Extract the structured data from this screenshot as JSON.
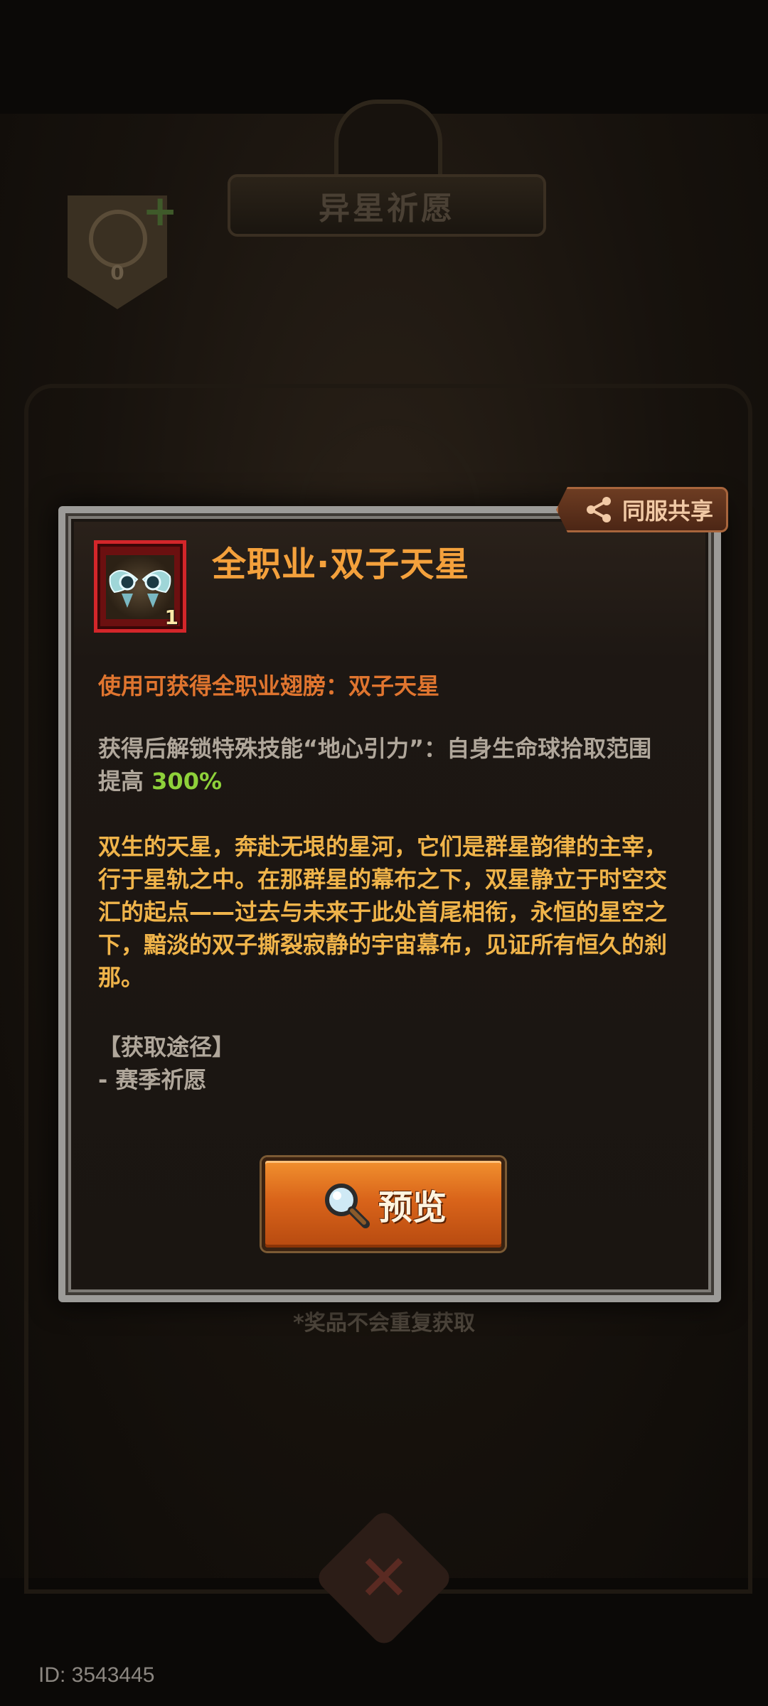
{
  "background": {
    "banner_title": "异星祈愿",
    "counter_value": "0",
    "note": "*奖品不会重复获取",
    "id_label": "ID: 3543445"
  },
  "dialog": {
    "share_label": "同服共享",
    "item": {
      "title": "全职业·双子天星",
      "count": "1",
      "icon": "twin-wings-icon"
    },
    "use_line": "使用可获得全职业翅膀：双子天星",
    "skill_line_prefix": "获得后解锁特殊技能“地心引力”：自身生命球拾取范围提高 ",
    "skill_value": "300%",
    "lore": "双生的天星，奔赴无垠的星河，它们是群星韵律的主宰，行于星轨之中。在那群星的幕布之下，双星静立于时空交汇的起点——过去与未来于此处首尾相衔，永恒的星空之下，黯淡的双子撕裂寂静的宇宙幕布，见证所有恒久的刹那。",
    "source_header": "【获取途径】",
    "source_item": "- 赛季祈愿",
    "preview_label": "预览"
  },
  "colors": {
    "title": "#f4a13c",
    "use_line": "#e0752f",
    "highlight": "#8ed13a",
    "lore": "#f0b44a",
    "button": "#d9641a"
  }
}
